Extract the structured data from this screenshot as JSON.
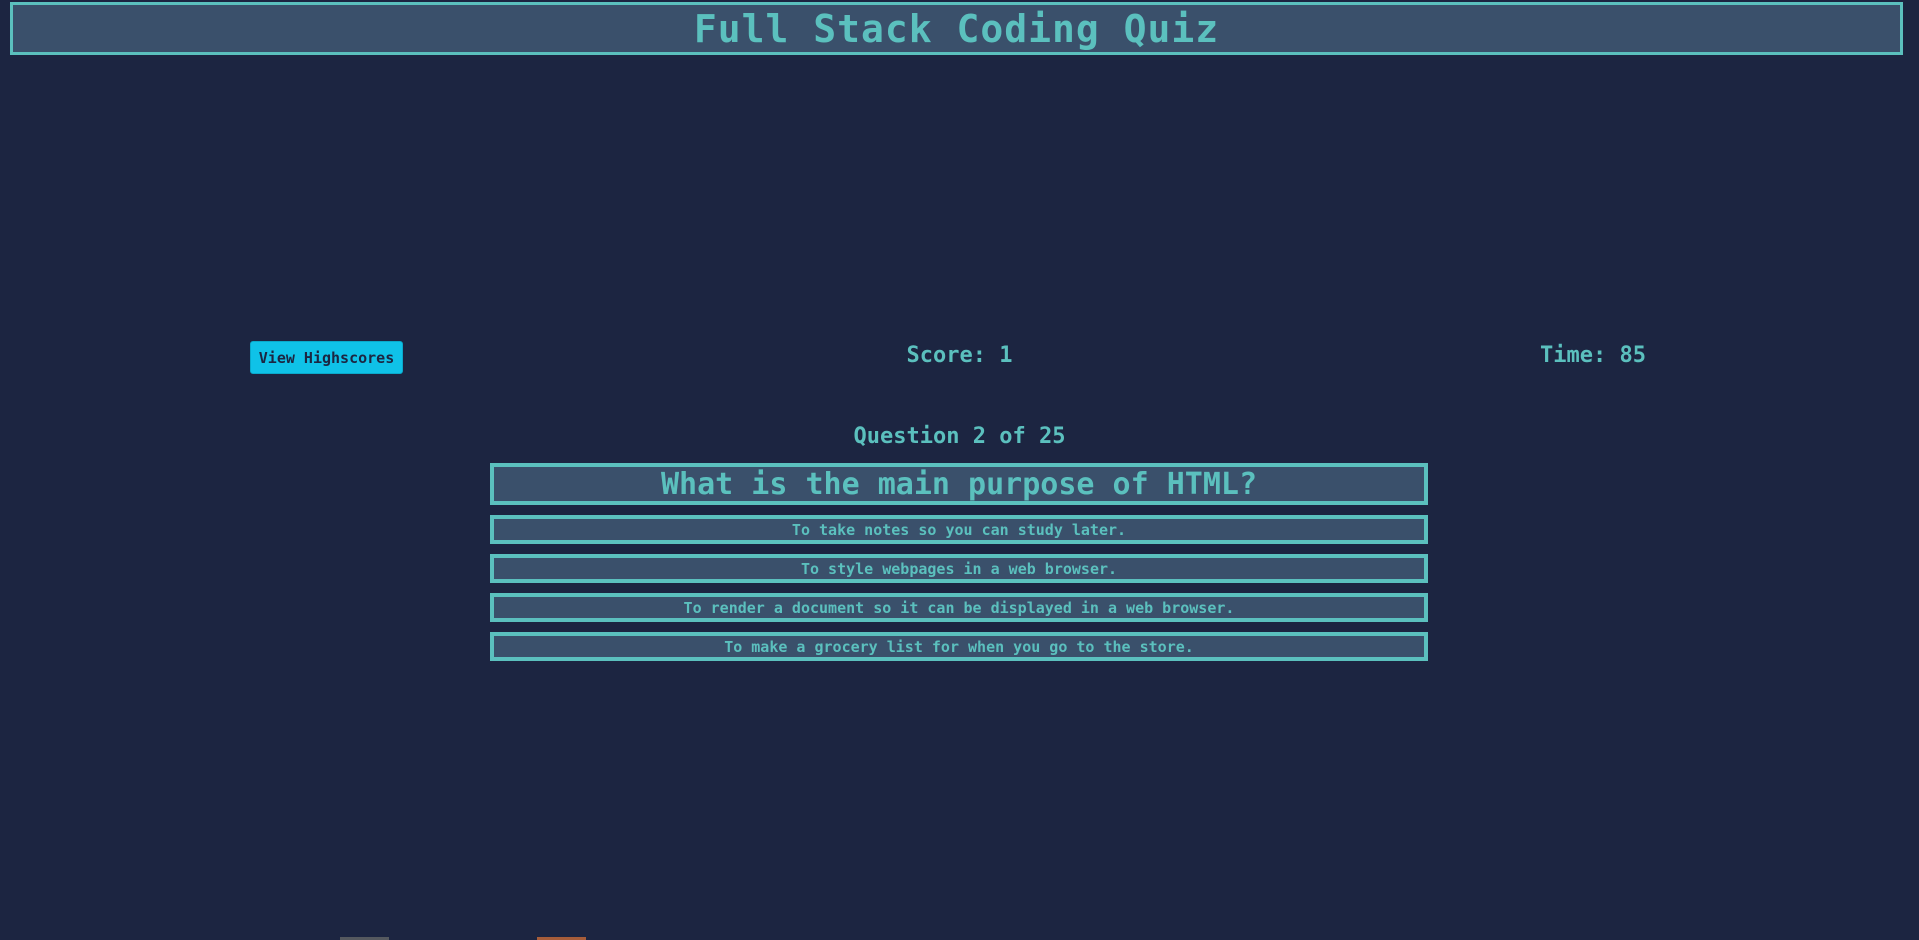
{
  "header": {
    "title": "Full Stack Coding Quiz"
  },
  "controls": {
    "highscores_label": "View Highscores"
  },
  "status": {
    "score_text": "Score: 1",
    "time_text": "Time: 85"
  },
  "quiz": {
    "counter_text": "Question 2 of 25",
    "question": "What is the main purpose of HTML?",
    "answers": [
      "To take notes so you can study later.",
      "To style webpages in a web browser.",
      "To render a document so it can be displayed in a web browser.",
      "To make a grocery list for when you go to the store."
    ]
  },
  "colors": {
    "background": "#1c2541",
    "panel": "#3a506b",
    "accent": "#5bc0be",
    "button": "#0fc2e8"
  }
}
